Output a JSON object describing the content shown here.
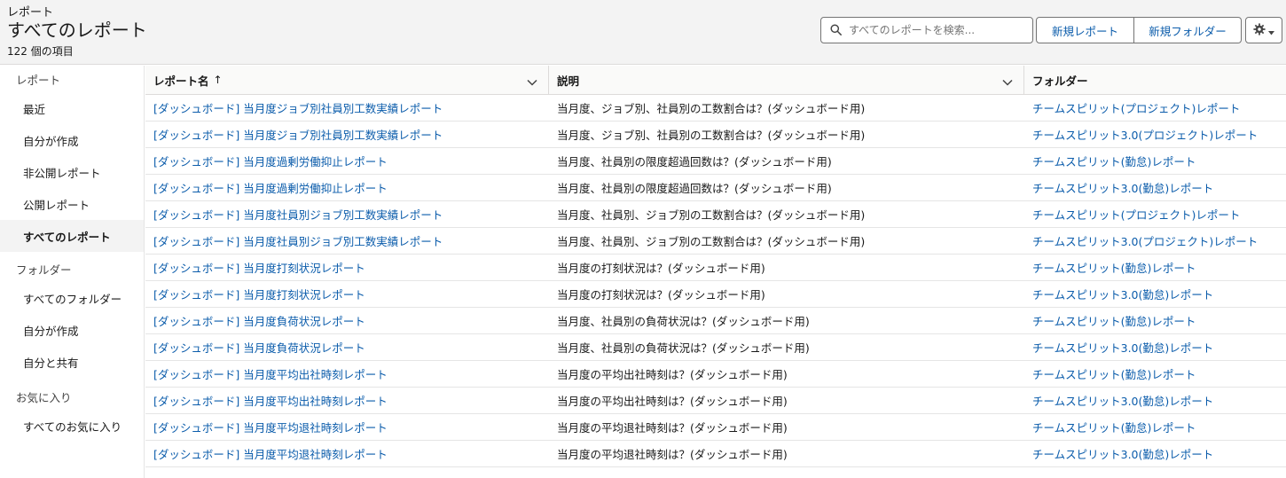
{
  "header": {
    "breadcrumb": "レポート",
    "title": "すべてのレポート",
    "count": "122 個の項目"
  },
  "search": {
    "placeholder": "すべてのレポートを検索..."
  },
  "toolbar": {
    "new_report_label": "新規レポート",
    "new_folder_label": "新規フォルダー"
  },
  "sidebar": {
    "reports_heading": "レポート",
    "report_items": [
      {
        "label": "最近"
      },
      {
        "label": "自分が作成"
      },
      {
        "label": "非公開レポート"
      },
      {
        "label": "公開レポート"
      },
      {
        "label": "すべてのレポート"
      }
    ],
    "folders_heading": "フォルダー",
    "folder_items": [
      {
        "label": "すべてのフォルダー"
      },
      {
        "label": "自分が作成"
      },
      {
        "label": "自分と共有"
      }
    ],
    "favorites_heading": "お気に入り",
    "favorite_items": [
      {
        "label": "すべてのお気に入り"
      }
    ],
    "active_item": "すべてのレポート"
  },
  "table": {
    "columns": [
      {
        "label": "レポート名",
        "sort": "↑"
      },
      {
        "label": "説明"
      },
      {
        "label": "フォルダー"
      }
    ],
    "rows": [
      {
        "name": "[ダッシュボード] 当月度ジョブ別社員別工数実績レポート",
        "description": "当月度、ジョブ別、社員別の工数割合は？(ダッシュボード用)",
        "folder": "チームスピリット(プロジェクト)レポート"
      },
      {
        "name": "[ダッシュボード] 当月度ジョブ別社員別工数実績レポート",
        "description": "当月度、ジョブ別、社員別の工数割合は？(ダッシュボード用)",
        "folder": "チームスピリット3.0(プロジェクト)レポート"
      },
      {
        "name": "[ダッシュボード] 当月度過剰労働抑止レポート",
        "description": "当月度、社員別の限度超過回数は？(ダッシュボード用)",
        "folder": "チームスピリット(勤怠)レポート"
      },
      {
        "name": "[ダッシュボード] 当月度過剰労働抑止レポート",
        "description": "当月度、社員別の限度超過回数は？(ダッシュボード用)",
        "folder": "チームスピリット3.0(勤怠)レポート"
      },
      {
        "name": "[ダッシュボード] 当月度社員別ジョブ別工数実績レポート",
        "description": "当月度、社員別、ジョブ別の工数割合は？(ダッシュボード用)",
        "folder": "チームスピリット(プロジェクト)レポート"
      },
      {
        "name": "[ダッシュボード] 当月度社員別ジョブ別工数実績レポート",
        "description": "当月度、社員別、ジョブ別の工数割合は？(ダッシュボード用)",
        "folder": "チームスピリット3.0(プロジェクト)レポート"
      },
      {
        "name": "[ダッシュボード] 当月度打刻状況レポート",
        "description": "当月度の打刻状況は？(ダッシュボード用)",
        "folder": "チームスピリット(勤怠)レポート"
      },
      {
        "name": "[ダッシュボード] 当月度打刻状況レポート",
        "description": "当月度の打刻状況は？(ダッシュボード用)",
        "folder": "チームスピリット3.0(勤怠)レポート"
      },
      {
        "name": "[ダッシュボード] 当月度負荷状況レポート",
        "description": "当月度、社員別の負荷状況は？(ダッシュボード用)",
        "folder": "チームスピリット(勤怠)レポート"
      },
      {
        "name": "[ダッシュボード] 当月度負荷状況レポート",
        "description": "当月度、社員別の負荷状況は？(ダッシュボード用)",
        "folder": "チームスピリット3.0(勤怠)レポート"
      },
      {
        "name": "[ダッシュボード] 当月度平均出社時刻レポート",
        "description": "当月度の平均出社時刻は？(ダッシュボード用)",
        "folder": "チームスピリット(勤怠)レポート"
      },
      {
        "name": "[ダッシュボード] 当月度平均出社時刻レポート",
        "description": "当月度の平均出社時刻は？(ダッシュボード用)",
        "folder": "チームスピリット3.0(勤怠)レポート"
      },
      {
        "name": "[ダッシュボード] 当月度平均退社時刻レポート",
        "description": "当月度の平均退社時刻は？(ダッシュボード用)",
        "folder": "チームスピリット(勤怠)レポート"
      },
      {
        "name": "[ダッシュボード] 当月度平均退社時刻レポート",
        "description": "当月度の平均退社時刻は？(ダッシュボード用)",
        "folder": "チームスピリット3.0(勤怠)レポート"
      }
    ]
  },
  "colors": {
    "link": "#0b5cab",
    "header_bg": "#f3f3f3",
    "border": "#dddbda"
  },
  "icons": [
    "search-icon",
    "gear-icon",
    "chevron-down-icon",
    "sort-arrow-icon"
  ]
}
